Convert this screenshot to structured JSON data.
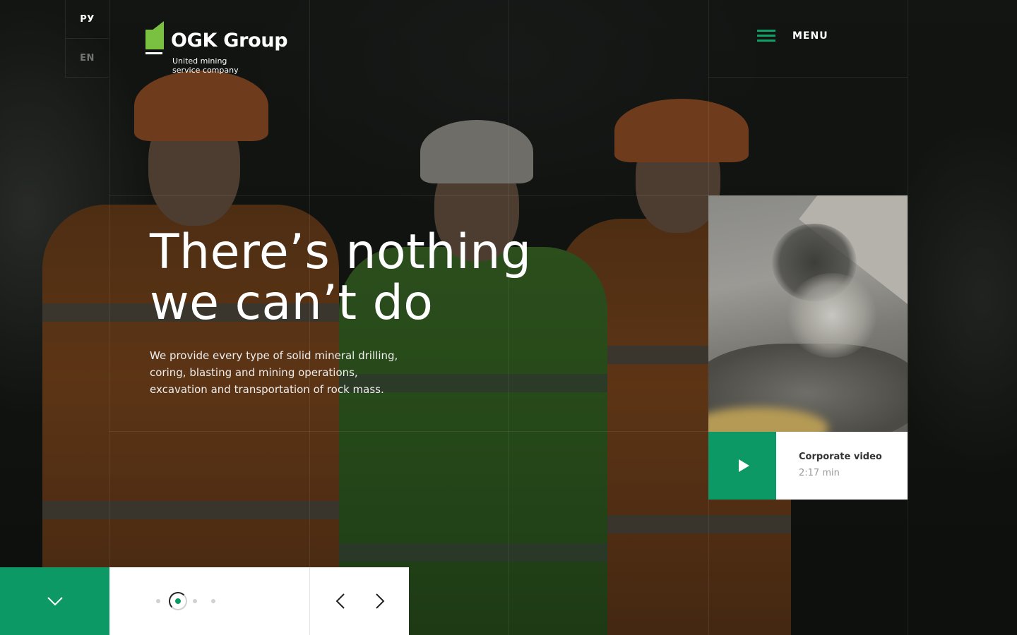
{
  "language": {
    "options": [
      "РУ",
      "EN"
    ],
    "active": "РУ"
  },
  "logo": {
    "name": "OGK Group",
    "tagline": "United mining service company",
    "brand_color": "#7ac142"
  },
  "menu": {
    "label": "MENU",
    "icon": "hamburger-icon"
  },
  "hero": {
    "title_line1": "There’s nothing",
    "title_line2": "we can’t do",
    "description": "We provide every type of solid mineral drilling, coring, blasting and mining operations, excavation and transportation of rock mass."
  },
  "video": {
    "title": "Corporate video",
    "duration": "2:17 min",
    "icon": "play-icon"
  },
  "slider": {
    "total_slides": 4,
    "active_slide": 2,
    "prev_icon": "chevron-left-icon",
    "next_icon": "chevron-right-icon"
  },
  "scroll": {
    "icon": "chevron-down-icon"
  },
  "colors": {
    "accent": "#0d9966",
    "background": "#141614",
    "text": "#ffffff"
  }
}
